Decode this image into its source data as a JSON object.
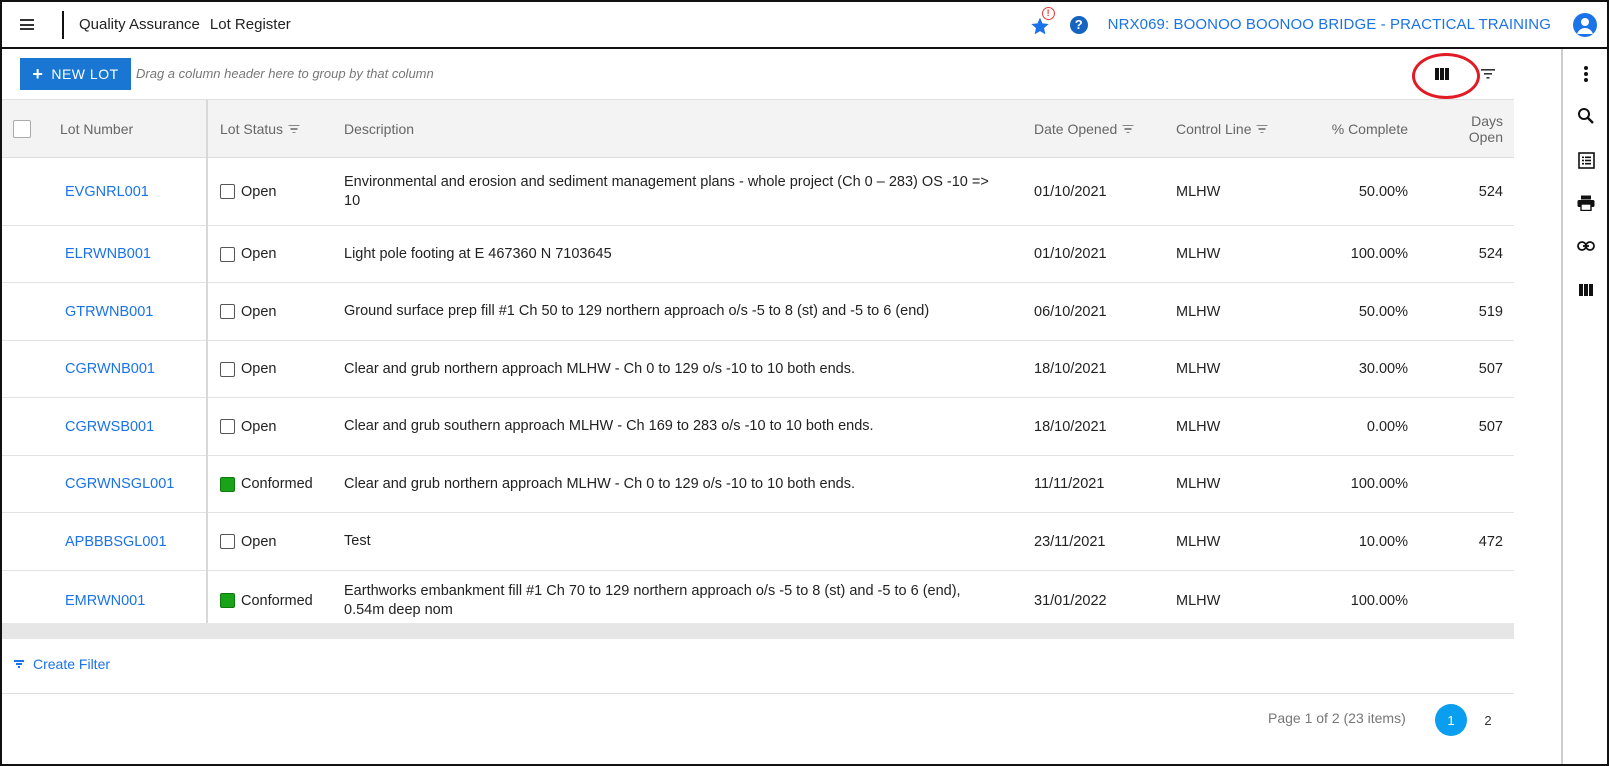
{
  "topbar": {
    "crumb_section": "Quality Assurance",
    "crumb_page": "Lot Register",
    "notification_badge": "!",
    "help_label": "?",
    "project": "NRX069: BOONOO BOONOO BRIDGE - PRACTICAL TRAINING"
  },
  "toolbar": {
    "new_lot_plus": "+",
    "new_lot_label": "NEW LOT",
    "group_hint": "Drag a column header here to group by that column"
  },
  "grid": {
    "headers": {
      "lot_number": "Lot Number",
      "lot_status": "Lot Status",
      "description": "Description",
      "date_opened": "Date Opened",
      "control_line": "Control Line",
      "percent_complete": "% Complete",
      "days_open_1": "Days",
      "days_open_2": "Open"
    },
    "rows": [
      {
        "lot": "EVGNRL001",
        "status": "Open",
        "desc": "Environmental and erosion and sediment management plans - whole project (Ch 0 – 283) OS -10 => 10",
        "date": "01/10/2021",
        "control": "MLHW",
        "pct": "50.00%",
        "days": "524"
      },
      {
        "lot": "ELRWNB001",
        "status": "Open",
        "desc": "Light pole footing at E 467360 N 7103645",
        "date": "01/10/2021",
        "control": "MLHW",
        "pct": "100.00%",
        "days": "524"
      },
      {
        "lot": "GTRWNB001",
        "status": "Open",
        "desc": "Ground surface prep fill #1 Ch 50 to 129 northern approach o/s -5 to 8 (st) and -5 to 6 (end)",
        "date": "06/10/2021",
        "control": "MLHW",
        "pct": "50.00%",
        "days": "519"
      },
      {
        "lot": "CGRWNB001",
        "status": "Open",
        "desc": "Clear and grub northern approach MLHW - Ch 0 to 129 o/s -10 to 10 both ends.",
        "date": "18/10/2021",
        "control": "MLHW",
        "pct": "30.00%",
        "days": "507"
      },
      {
        "lot": "CGRWSB001",
        "status": "Open",
        "desc": "Clear and grub southern approach MLHW - Ch 169 to 283 o/s -10 to 10 both ends.",
        "date": "18/10/2021",
        "control": "MLHW",
        "pct": "0.00%",
        "days": "507"
      },
      {
        "lot": "CGRWNSGL001",
        "status": "Conformed",
        "desc": "Clear and grub northern approach MLHW - Ch 0 to 129 o/s -10 to 10 both ends.",
        "date": "11/11/2021",
        "control": "MLHW",
        "pct": "100.00%",
        "days": ""
      },
      {
        "lot": "APBBBSGL001",
        "status": "Open",
        "desc": "Test",
        "date": "23/11/2021",
        "control": "MLHW",
        "pct": "10.00%",
        "days": "472"
      },
      {
        "lot": "EMRWN001",
        "status": "Conformed",
        "desc": "Earthworks embankment fill #1 Ch 70 to 129 northern approach o/s -5 to 8 (st) and -5 to 6 (end), 0.54m deep nom",
        "date": "31/01/2022",
        "control": "MLHW",
        "pct": "100.00%",
        "days": ""
      }
    ]
  },
  "footer": {
    "create_filter": "Create Filter",
    "page_info": "Page 1 of 2 (23 items)",
    "pages": [
      "1",
      "2"
    ]
  },
  "colors": {
    "accent": "#1a73e8",
    "button": "#1976d2",
    "conformed": "#19a319",
    "highlight": "#e01b24"
  }
}
